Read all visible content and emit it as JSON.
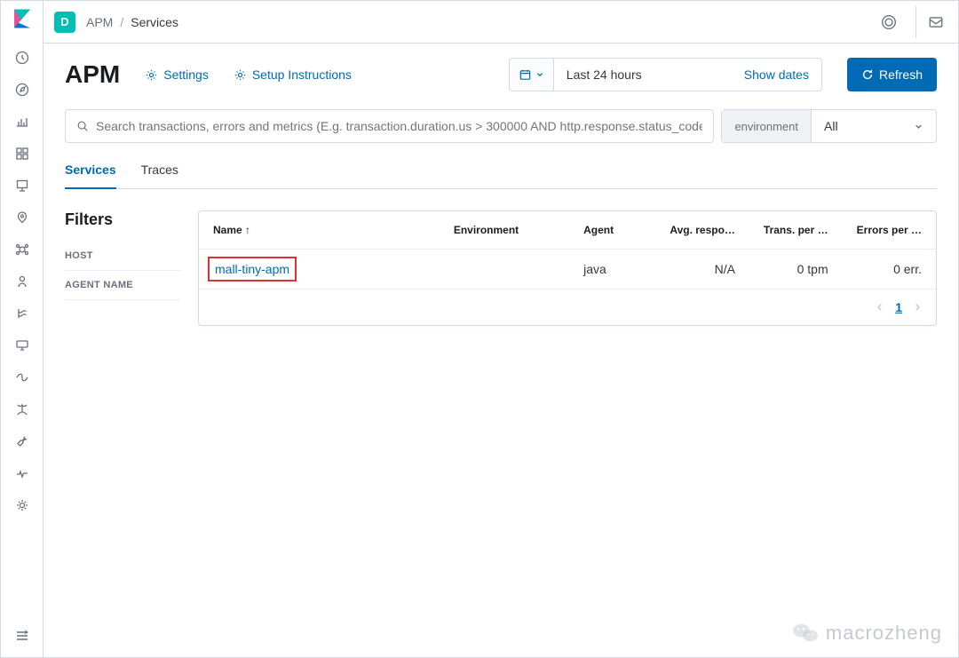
{
  "breadcrumb": {
    "app": "APM",
    "current": "Services",
    "space_letter": "D"
  },
  "header": {
    "title": "APM",
    "settings_label": "Settings",
    "setup_label": "Setup Instructions",
    "datepicker_value": "Last 24 hours",
    "show_dates_label": "Show dates",
    "refresh_label": "Refresh"
  },
  "search": {
    "placeholder": "Search transactions, errors and metrics (E.g. transaction.duration.us > 300000 AND http.response.status_code >=",
    "env_label": "environment",
    "env_value": "All"
  },
  "tabs": {
    "services": "Services",
    "traces": "Traces"
  },
  "filters": {
    "title": "Filters",
    "items": [
      "HOST",
      "AGENT NAME"
    ]
  },
  "table": {
    "columns": {
      "name": "Name ↑",
      "environment": "Environment",
      "agent": "Agent",
      "avg_response": "Avg. respo…",
      "tpm": "Trans. per …",
      "errors": "Errors per …"
    },
    "rows": [
      {
        "name": "mall-tiny-apm",
        "environment": "",
        "agent": "java",
        "avg_response": "N/A",
        "tpm": "0 tpm",
        "errors": "0 err."
      }
    ]
  },
  "pagination": {
    "current": "1"
  },
  "watermark": "macrozheng"
}
